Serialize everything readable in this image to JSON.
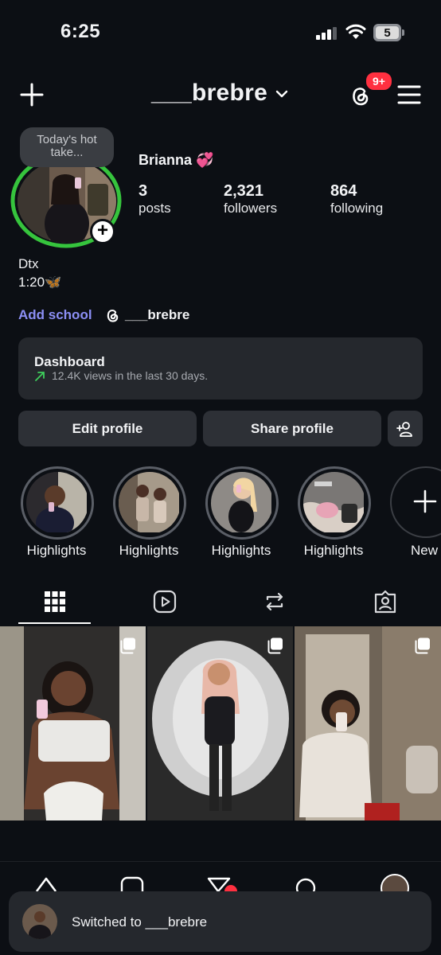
{
  "status_bar": {
    "time": "6:25",
    "battery": "5"
  },
  "header": {
    "username": "___brebre",
    "notification_badge": "9+"
  },
  "profile": {
    "note": "Today's hot take...",
    "full_name": "Brianna 💞",
    "stats": [
      {
        "value": "3",
        "label": "posts"
      },
      {
        "value": "2,321",
        "label": "followers"
      },
      {
        "value": "864",
        "label": "following"
      }
    ],
    "bio_line1": "Dtx",
    "bio_line2": "1:20🦋",
    "add_school": "Add school",
    "threads_handle": "___brebre"
  },
  "dashboard": {
    "title": "Dashboard",
    "subtitle": "12.4K views in the last 30 days."
  },
  "actions": {
    "edit_profile": "Edit profile",
    "share_profile": "Share profile"
  },
  "highlights": [
    {
      "label": "Highlights"
    },
    {
      "label": "Highlights"
    },
    {
      "label": "Highlights"
    },
    {
      "label": "Highlights"
    },
    {
      "label": "New"
    }
  ],
  "toast": {
    "text": "Switched to ___brebre"
  },
  "colors": {
    "accent_link": "#8c8ff5",
    "badge": "#ff3040",
    "story_ring": "#36c43d",
    "background": "#0c0f14"
  }
}
